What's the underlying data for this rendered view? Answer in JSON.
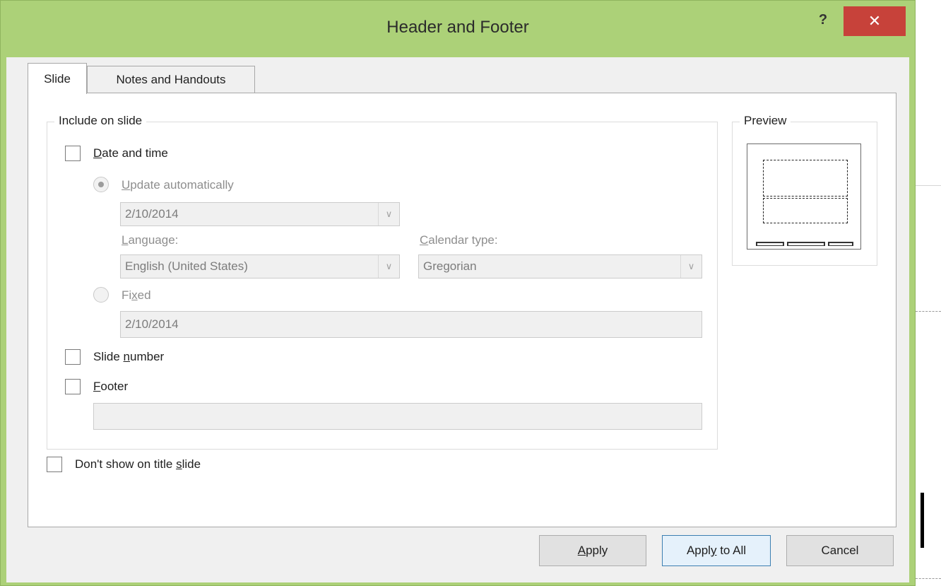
{
  "dialog": {
    "title": "Header and Footer",
    "help_glyph": "?",
    "close_glyph": "✕"
  },
  "tabs": [
    {
      "label": "Slide",
      "active": true
    },
    {
      "label": "Notes and Handouts",
      "active": false
    }
  ],
  "include_group": {
    "legend": "Include on slide",
    "date_time": {
      "label_first": "D",
      "label_rest": "ate and time",
      "checked": false
    },
    "update_automatically": {
      "label_first": "U",
      "label_rest": "pdate automatically",
      "selected": true,
      "enabled": false
    },
    "date_combo": {
      "value": "2/10/2014"
    },
    "language": {
      "label_first": "L",
      "label_rest": "anguage:",
      "value": "English (United States)"
    },
    "calendar_type": {
      "label_first": "C",
      "label_rest": "alendar type:",
      "value": "Gregorian"
    },
    "fixed": {
      "label_a": "Fi",
      "label_u": "x",
      "label_b": "ed",
      "selected": false,
      "enabled": false,
      "value": "2/10/2014"
    },
    "slide_number": {
      "label_a": "Slide ",
      "label_u": "n",
      "label_b": "umber",
      "checked": false
    },
    "footer": {
      "label_first": "F",
      "label_rest": "ooter",
      "checked": false,
      "value": ""
    }
  },
  "dont_show_title": {
    "label_a": "Don't show on title ",
    "label_u": "s",
    "label_b": "lide",
    "checked": false
  },
  "preview": {
    "legend": "Preview"
  },
  "buttons": {
    "apply": {
      "label_u": "A",
      "label_rest": "pply"
    },
    "apply_all": {
      "label_a": "Appl",
      "label_u": "y",
      "label_b": " to All"
    },
    "cancel": {
      "label": "Cancel"
    }
  },
  "colors": {
    "title_bar": "#acd178",
    "close_button": "#c7423a",
    "default_button_border": "#3c7fb1"
  }
}
